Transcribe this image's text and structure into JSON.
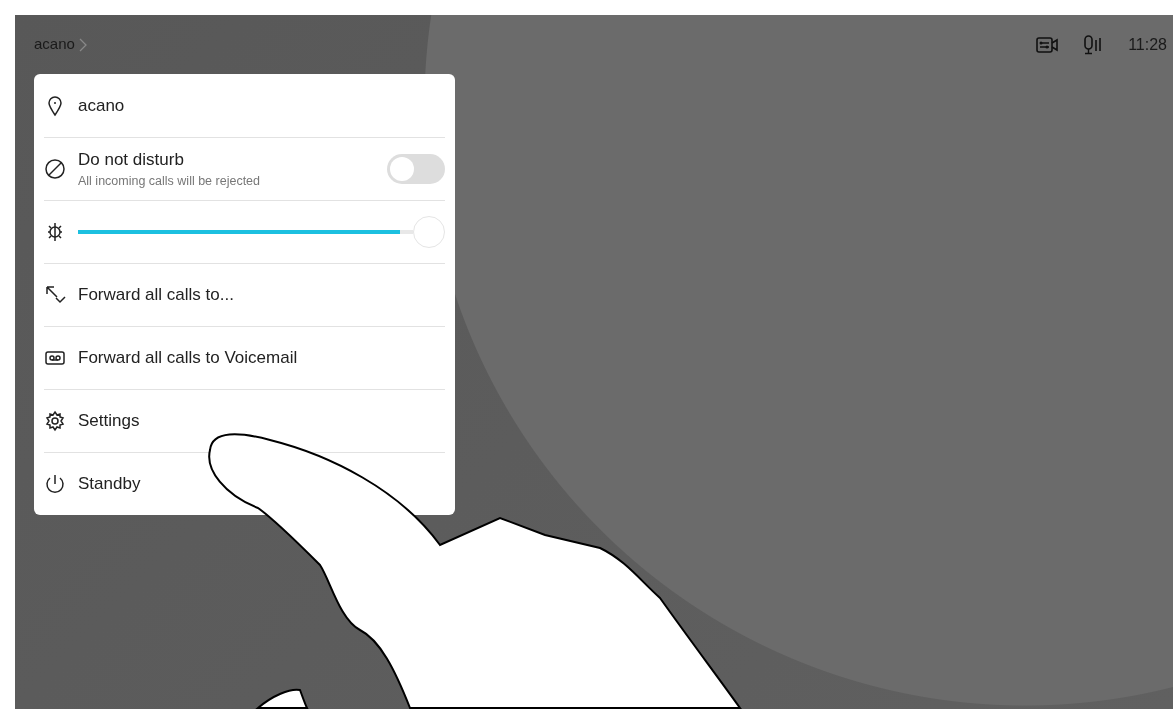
{
  "header": {
    "title": "acano"
  },
  "status_bar": {
    "time": "11:28"
  },
  "menu": [
    {
      "kind": "item",
      "label": "acano"
    },
    {
      "kind": "toggle",
      "label": "Do not disturb",
      "subtitle": "All incoming calls will be rejected",
      "on": false
    },
    {
      "kind": "slider",
      "level": 0.96
    },
    {
      "kind": "item",
      "label": "Forward all calls to..."
    },
    {
      "kind": "item",
      "label": "Forward all calls to Voicemail"
    },
    {
      "kind": "item",
      "label": "Settings"
    },
    {
      "kind": "item",
      "label": "Standby"
    }
  ]
}
